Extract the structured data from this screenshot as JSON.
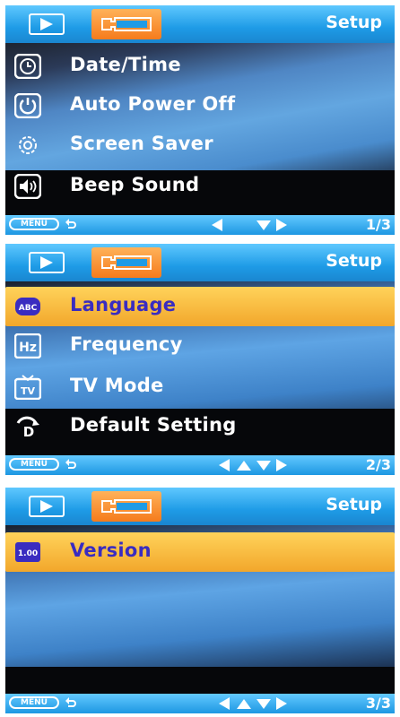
{
  "screens": [
    {
      "title": "Setup",
      "items": [
        {
          "label": "Date/Time",
          "icon": "clock-icon"
        },
        {
          "label": "Auto Power Off",
          "icon": "power-icon"
        },
        {
          "label": "Screen Saver",
          "icon": "gear-icon"
        },
        {
          "label": "Beep Sound",
          "icon": "speaker-icon"
        }
      ],
      "footer": {
        "menu": "MENU",
        "page": "1/3"
      }
    },
    {
      "title": "Setup",
      "items": [
        {
          "label": "Language",
          "icon": "abc-icon",
          "selected": true
        },
        {
          "label": "Frequency",
          "icon": "hz-icon"
        },
        {
          "label": "TV Mode",
          "icon": "tv-icon"
        },
        {
          "label": "Default Setting",
          "icon": "default-setting-icon"
        }
      ],
      "footer": {
        "menu": "MENU",
        "page": "2/3"
      }
    },
    {
      "title": "Setup",
      "items": [
        {
          "label": "Version",
          "icon": "version-icon",
          "icon_text": "1.00",
          "selected": true
        }
      ],
      "footer": {
        "menu": "MENU",
        "page": "3/3"
      }
    }
  ],
  "colors": {
    "header": "#1e9be6",
    "setup_tab": "#f57b1c",
    "selected_row": "#f2a72b",
    "selected_text": "#3a2cc0"
  }
}
